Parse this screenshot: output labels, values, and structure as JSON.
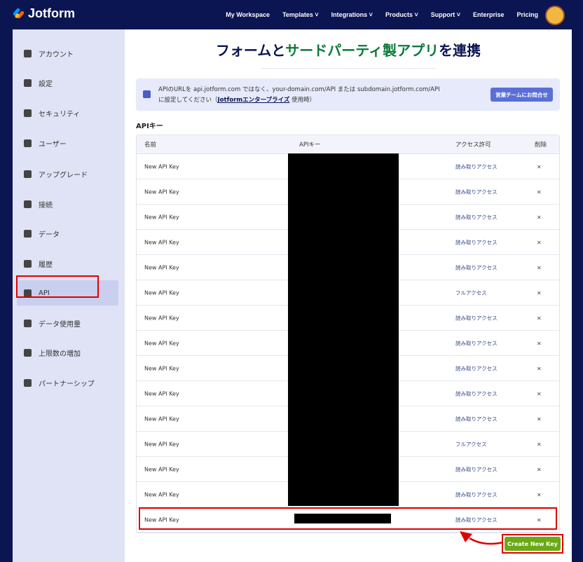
{
  "nav": {
    "brand": "Jotform",
    "links": [
      "My Workspace",
      "Templates ˅",
      "Integrations ˅",
      "Products ˅",
      "Support ˅",
      "Enterprise",
      "Pricing"
    ]
  },
  "sidebar": {
    "items": [
      {
        "label": "アカウント",
        "icon": "user-icon"
      },
      {
        "label": "設定",
        "icon": "gear-icon"
      },
      {
        "label": "セキュリティ",
        "icon": "lock-icon"
      },
      {
        "label": "ユーザー",
        "icon": "users-icon"
      },
      {
        "label": "アップグレード",
        "icon": "upgrade-icon"
      },
      {
        "label": "接続",
        "icon": "plug-icon"
      },
      {
        "label": "データ",
        "icon": "database-icon"
      },
      {
        "label": "履歴",
        "icon": "history-icon"
      },
      {
        "label": "API",
        "icon": "api-icon"
      },
      {
        "label": "データ使用量",
        "icon": "bar-chart-icon"
      },
      {
        "label": "上限数の増加",
        "icon": "gift-icon"
      },
      {
        "label": "パートナーシップ",
        "icon": "handshake-icon"
      }
    ]
  },
  "page": {
    "title_a": "フォームと",
    "title_b": "サードパーティ製アプリ",
    "title_c": "を連携",
    "banner": {
      "text1": "APIのURLを api.jotform.com ではなく、your-domain.com/API または subdomain.jotform.com/API に設定してください（",
      "link": "Jotformエンタープライズ",
      "text2": " 使用時）",
      "button": "営業チームにお問合せ"
    },
    "section": "APIキー",
    "headers": [
      "名前",
      "APIキー",
      "アクセス許可",
      "削除"
    ],
    "rows": [
      {
        "name": "New API Key",
        "access": "読み取りアクセス"
      },
      {
        "name": "New API Key",
        "access": "読み取りアクセス"
      },
      {
        "name": "New API Key",
        "access": "読み取りアクセス"
      },
      {
        "name": "New API Key",
        "access": "読み取りアクセス"
      },
      {
        "name": "New API Key",
        "access": "読み取りアクセス"
      },
      {
        "name": "New API Key",
        "access": "フルアクセス"
      },
      {
        "name": "New API Key",
        "access": "読み取りアクセス"
      },
      {
        "name": "New API Key",
        "access": "読み取りアクセス"
      },
      {
        "name": "New API Key",
        "access": "読み取りアクセス"
      },
      {
        "name": "New API Key",
        "access": "読み取りアクセス"
      },
      {
        "name": "New API Key",
        "access": "読み取りアクセス"
      },
      {
        "name": "New API Key",
        "access": "フルアクセス"
      },
      {
        "name": "New API Key",
        "access": "読み取りアクセス"
      },
      {
        "name": "New API Key",
        "access": "読み取りアクセス"
      },
      {
        "name": "New API Key",
        "access": "読み取りアクセス"
      }
    ],
    "delete_glyph": "×",
    "create_button": "Create New Key"
  }
}
